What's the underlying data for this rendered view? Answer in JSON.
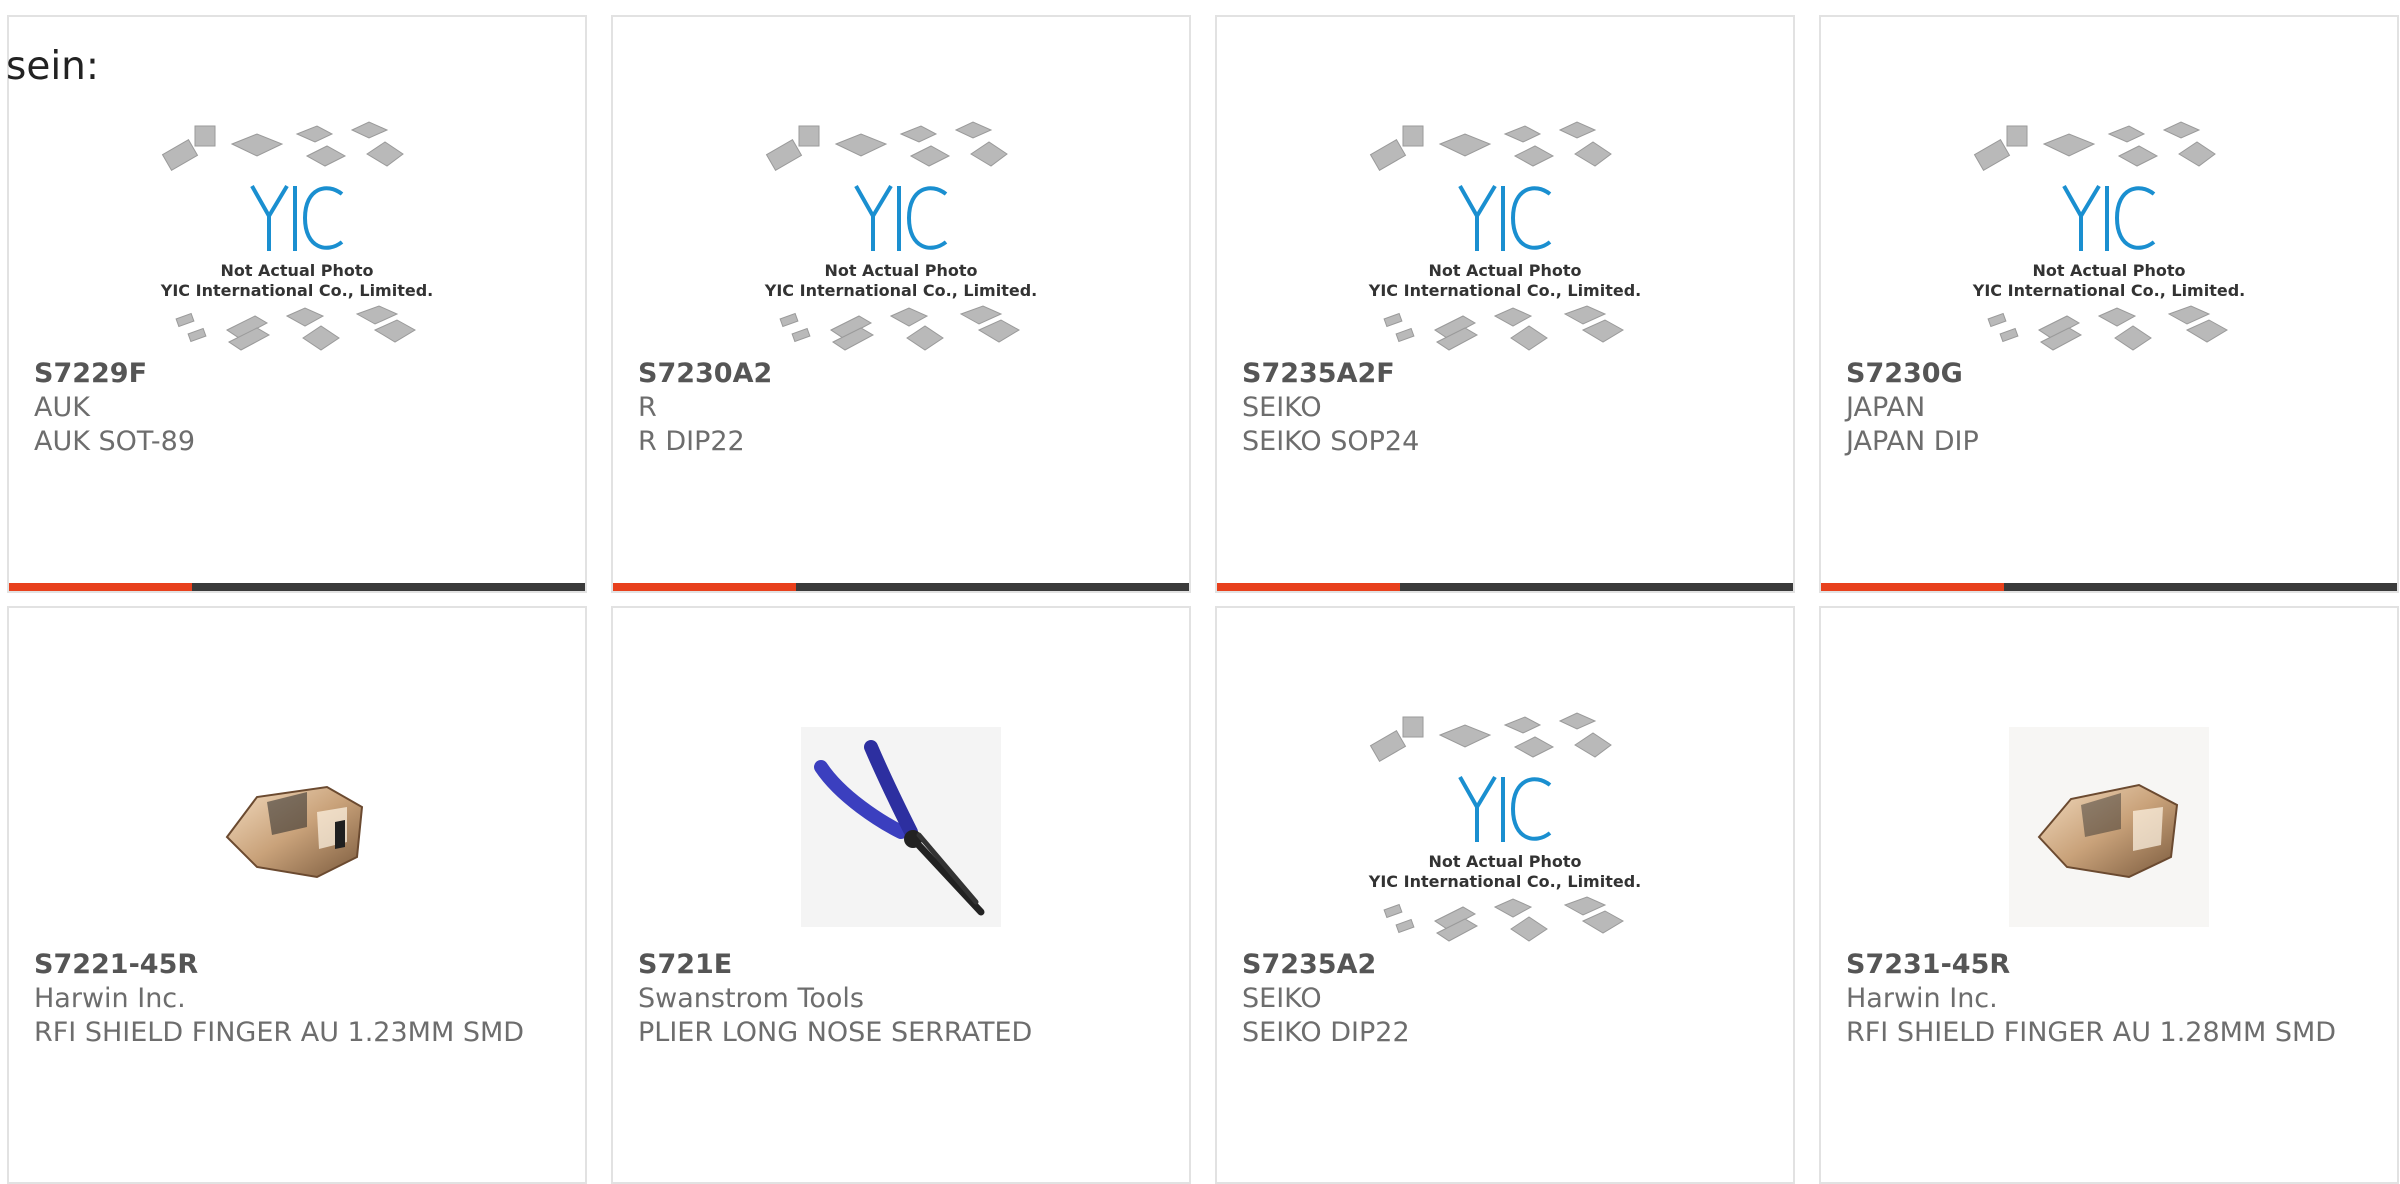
{
  "lead_text": "sein:",
  "placeholder": {
    "logo": "YIC",
    "line1": "Not Actual Photo",
    "line2": "YIC International Co., Limited."
  },
  "colors": {
    "accent": "#e8401c",
    "bar": "#3a3a3a",
    "logo": "#1a8fd0",
    "border": "#e2e2e2",
    "text": "#6d6d6d"
  },
  "products": [
    {
      "part": "S7229F",
      "maker": "AUK",
      "desc": "AUK SOT-89",
      "image": "placeholder-image"
    },
    {
      "part": "S7230A2",
      "maker": "R",
      "desc": "R DIP22",
      "image": "placeholder-image"
    },
    {
      "part": "S7235A2F",
      "maker": "SEIKO",
      "desc": "SEIKO SOP24",
      "image": "placeholder-image"
    },
    {
      "part": "S7230G",
      "maker": "JAPAN",
      "desc": "JAPAN DIP",
      "image": "placeholder-image"
    },
    {
      "part": "S7221-45R",
      "maker": "Harwin Inc.",
      "desc": "RFI SHIELD FINGER AU 1.23MM SMD",
      "image": "shield-finger-photo"
    },
    {
      "part": "S721E",
      "maker": "Swanstrom Tools",
      "desc": "PLIER LONG NOSE SERRATED",
      "image": "plier-photo"
    },
    {
      "part": "S7235A2",
      "maker": "SEIKO",
      "desc": "SEIKO DIP22",
      "image": "placeholder-image"
    },
    {
      "part": "S7231-45R",
      "maker": "Harwin Inc.",
      "desc": "RFI SHIELD FINGER AU 1.28MM SMD",
      "image": "shield-finger-photo"
    }
  ]
}
